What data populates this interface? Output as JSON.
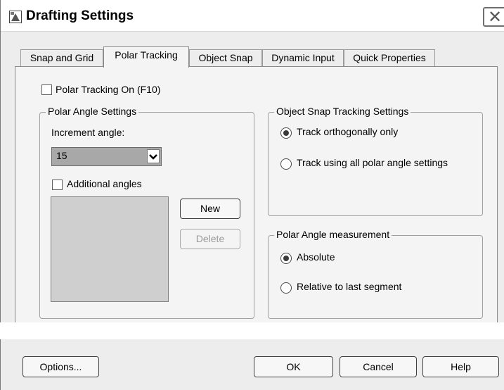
{
  "window": {
    "title": "Drafting Settings"
  },
  "tabs": [
    {
      "label": "Snap and Grid",
      "active": false
    },
    {
      "label": "Polar Tracking",
      "active": true
    },
    {
      "label": "Object Snap",
      "active": false
    },
    {
      "label": "Dynamic Input",
      "active": false
    },
    {
      "label": "Quick Properties",
      "active": false
    }
  ],
  "polar_tracking_on": {
    "label": "Polar Tracking On (F10)",
    "checked": false
  },
  "polar_angle_settings": {
    "legend": "Polar Angle Settings",
    "increment_label": "Increment angle:",
    "increment_value": "15",
    "additional_angles": {
      "label": "Additional angles",
      "checked": false
    },
    "new_button": "New",
    "delete_button": "Delete"
  },
  "object_snap_tracking": {
    "legend": "Object Snap Tracking Settings",
    "options": [
      {
        "label": "Track orthogonally only",
        "selected": true
      },
      {
        "label": "Track using all polar angle settings",
        "selected": false
      }
    ]
  },
  "polar_angle_measurement": {
    "legend": "Polar Angle measurement",
    "options": [
      {
        "label": "Absolute",
        "selected": true
      },
      {
        "label": "Relative to last segment",
        "selected": false
      }
    ]
  },
  "footer": {
    "options": "Options...",
    "ok": "OK",
    "cancel": "Cancel",
    "help": "Help"
  },
  "colors": {
    "panel": "#f4f4f4",
    "window": "#ededed",
    "select_bg": "#a8a8a8",
    "listbox_bg": "#cfcfcf"
  }
}
